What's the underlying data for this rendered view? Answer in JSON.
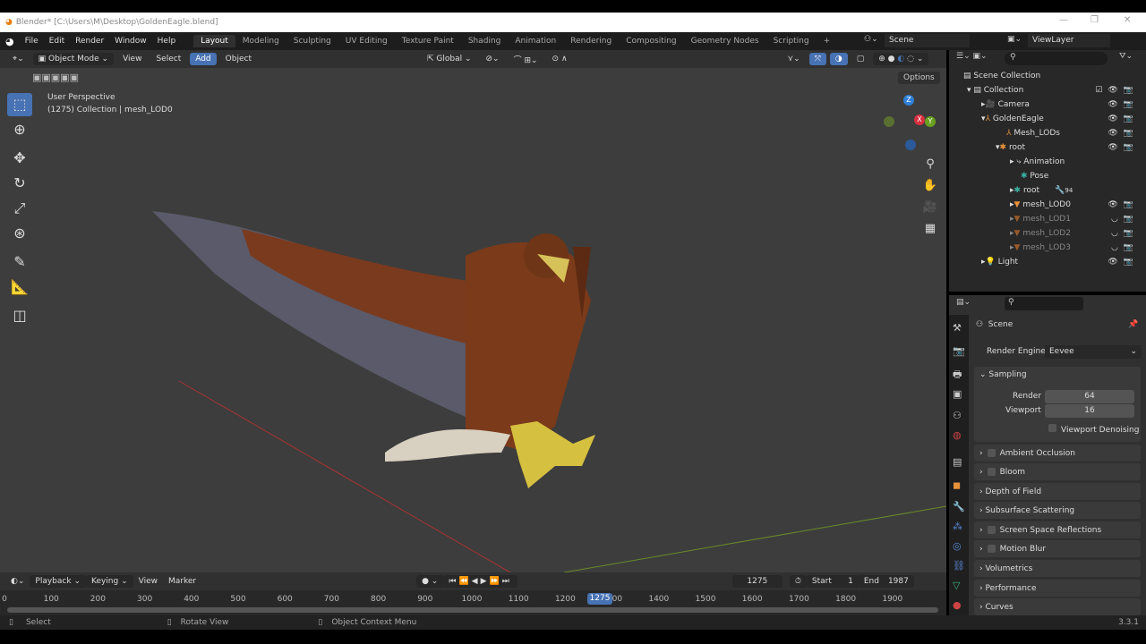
{
  "title": "Blender* [C:\\Users\\M\\Desktop\\GoldenEagle.blend]",
  "menu": [
    "File",
    "Edit",
    "Render",
    "Window",
    "Help"
  ],
  "workspaces": [
    "Layout",
    "Modeling",
    "Sculpting",
    "UV Editing",
    "Texture Paint",
    "Shading",
    "Animation",
    "Rendering",
    "Compositing",
    "Geometry Nodes",
    "Scripting",
    "+"
  ],
  "scene": "Scene",
  "view_layer": "ViewLayer",
  "viewport_header": {
    "mode": "Object Mode",
    "view": "View",
    "select": "Select",
    "add": "Add",
    "object": "Object",
    "orientation": "Global",
    "options": "Options"
  },
  "viewport": {
    "perspective": "User Perspective",
    "info": "(1275) Collection | mesh_LOD0",
    "gizmo": {
      "x": "X",
      "y": "Y",
      "z": "Z"
    }
  },
  "outliner": {
    "root": "Scene Collection",
    "items": [
      {
        "label": "Collection",
        "dim": false
      },
      {
        "label": "Camera",
        "dim": false
      },
      {
        "label": "GoldenEagle",
        "dim": false
      },
      {
        "label": "Mesh_LODs",
        "dim": false
      },
      {
        "label": "root",
        "dim": false
      },
      {
        "label": "Animation",
        "dim": false
      },
      {
        "label": "Pose",
        "dim": false
      },
      {
        "label": "root",
        "dim": false,
        "badge": "94"
      },
      {
        "label": "mesh_LOD0",
        "dim": false
      },
      {
        "label": "mesh_LOD1",
        "dim": true
      },
      {
        "label": "mesh_LOD2",
        "dim": true
      },
      {
        "label": "mesh_LOD3",
        "dim": true
      },
      {
        "label": "Light",
        "dim": false
      }
    ]
  },
  "properties": {
    "context": "Scene",
    "render_engine_label": "Render Engine",
    "render_engine": "Eevee",
    "sampling": "Sampling",
    "render_label": "Render",
    "render_value": "64",
    "viewport_label": "Viewport",
    "viewport_value": "16",
    "denoise": "Viewport Denoising",
    "panels": [
      "Ambient Occlusion",
      "Bloom",
      "Depth of Field",
      "Subsurface Scattering",
      "Screen Space Reflections",
      "Motion Blur",
      "Volumetrics",
      "Performance",
      "Curves"
    ]
  },
  "timeline": {
    "playback": "Playback",
    "keying": "Keying",
    "view": "View",
    "marker": "Marker",
    "current": "1275",
    "start_label": "Start",
    "start": "1",
    "end_label": "End",
    "end": "1987",
    "ticks": [
      "0",
      "100",
      "200",
      "300",
      "400",
      "500",
      "600",
      "700",
      "800",
      "900",
      "1000",
      "1100",
      "1200",
      "1300",
      "1400",
      "1500",
      "1600",
      "1700",
      "1800",
      "1900"
    ]
  },
  "status": {
    "select": "Select",
    "rotate": "Rotate View",
    "context": "Object Context Menu",
    "version": "3.3.1"
  }
}
